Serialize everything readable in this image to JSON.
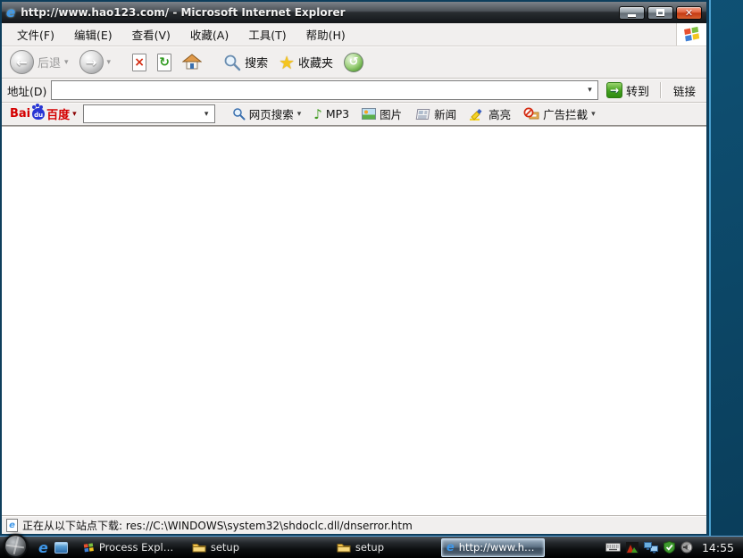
{
  "window": {
    "title": "http://www.hao123.com/ - Microsoft Internet Explorer",
    "menu": {
      "file": "文件(F)",
      "edit": "编辑(E)",
      "view": "查看(V)",
      "favorites": "收藏(A)",
      "tools": "工具(T)",
      "help": "帮助(H)"
    },
    "toolbar": {
      "back_label": "后退",
      "search_label": "搜索",
      "favorites_label": "收藏夹"
    },
    "address_bar": {
      "label": "地址(D)",
      "value": "",
      "go_label": "转到",
      "links_label": "链接"
    },
    "baidu_bar": {
      "logo_bai": "Bai",
      "logo_du": "du",
      "logo_cn": "百度",
      "search_value": "",
      "web_search": "网页搜索",
      "mp3": "MP3",
      "images": "图片",
      "news": "新闻",
      "highlight": "高亮",
      "ad_block": "广告拦截"
    },
    "status_bar": {
      "text": "正在从以下站点下载: res://C:\\WINDOWS\\system32\\shdoclc.dll/dnserror.htm"
    }
  },
  "taskbar": {
    "tasks": [
      {
        "label": "Process Explorer ...",
        "icon": "windows-app-icon",
        "active": false
      },
      {
        "label": "setup",
        "icon": "folder-icon",
        "active": false
      },
      {
        "label": "setup",
        "icon": "folder-icon",
        "active": false
      },
      {
        "label": "http://www.hao...",
        "icon": "ie-icon",
        "active": true
      }
    ],
    "clock": "14:55"
  },
  "icons": {
    "ie_logo": "e",
    "back_arrow": "←",
    "forward_arrow": "→",
    "dropdown_caret": "▾",
    "stop_glyph": "×",
    "refresh_glyph": "↻",
    "favorites_star": "★",
    "history_glyph": "↺",
    "go_arrow": "→",
    "mp3_note": "♪"
  },
  "colors": {
    "desktop_teal": "#0d4a6b",
    "frame_highlight": "#4ba0cf",
    "titlebar_dark": "#131619",
    "close_red": "#c33a12",
    "go_green": "#2f8a12",
    "baidu_red": "#d40000",
    "baidu_blue": "#2836d4",
    "toolbar_gray": "#f1efee"
  }
}
